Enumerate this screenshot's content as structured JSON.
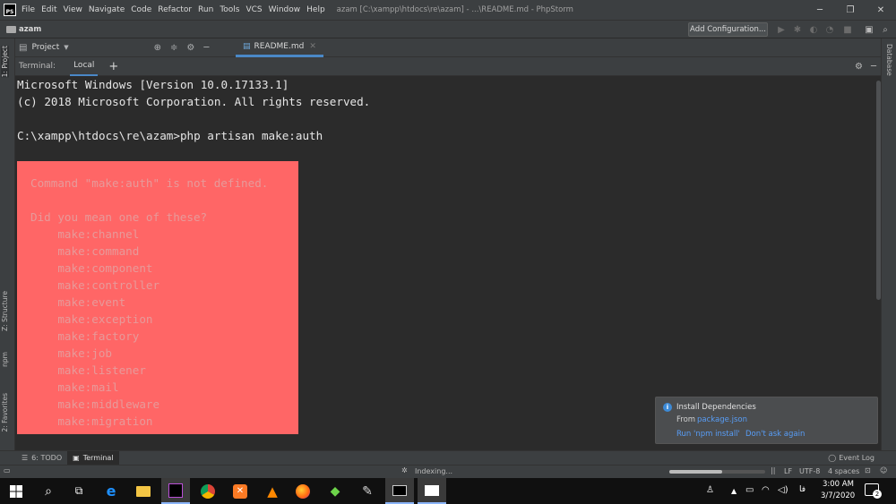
{
  "titlebar": {
    "menu": [
      "File",
      "Edit",
      "View",
      "Navigate",
      "Code",
      "Refactor",
      "Run",
      "Tools",
      "VCS",
      "Window",
      "Help"
    ],
    "window_title": "azam [C:\\xampp\\htdocs\\re\\azam] - ...\\README.md - PhpStorm"
  },
  "navbar": {
    "project_name": "azam",
    "add_config_label": "Add Configuration..."
  },
  "left_stripe": {
    "project_tab": "1: Project",
    "structure_tab": "Z: Structure",
    "npm_tab": "npm",
    "favorites_tab": "2: Favorites"
  },
  "right_stripe": {
    "database_tab": "Database"
  },
  "project_toolbar": {
    "project_label": "Project",
    "editor_tab": "README.md"
  },
  "terminal": {
    "label": "Terminal:",
    "tab": "Local",
    "add": "+",
    "lines": [
      "Microsoft Windows [Version 10.0.17133.1]",
      "(c) 2018 Microsoft Corporation. All rights reserved.",
      "C:\\xampp\\htdocs\\re\\azam>php artisan make:auth"
    ],
    "error_lines": [
      "Command \"make:auth\" is not defined.",
      "Did you mean one of these?",
      "    make:channel",
      "    make:command",
      "    make:component",
      "    make:controller",
      "    make:event",
      "    make:exception",
      "    make:factory",
      "    make:job",
      "    make:listener",
      "    make:mail",
      "    make:middleware",
      "    make:migration"
    ]
  },
  "notification": {
    "title": "Install Dependencies",
    "from_label": "From",
    "from_link": "package.json",
    "action_install": "Run 'npm install'",
    "action_dismiss": "Don't ask again"
  },
  "tool_tabs": {
    "todo": "6: TODO",
    "terminal": "Terminal",
    "event_log": "Event Log"
  },
  "status": {
    "indexing": "Indexing...",
    "line_sep": "LF",
    "encoding": "UTF-8",
    "indent": "4 spaces",
    "indexing_progress": 0.55
  },
  "taskbar": {
    "time": "3:00 AM",
    "date": "3/7/2020",
    "lang": "فا",
    "notif_count": "2"
  },
  "colors": {
    "error_bg": "#ff6666",
    "accent": "#4a88c7",
    "link": "#589df6"
  }
}
